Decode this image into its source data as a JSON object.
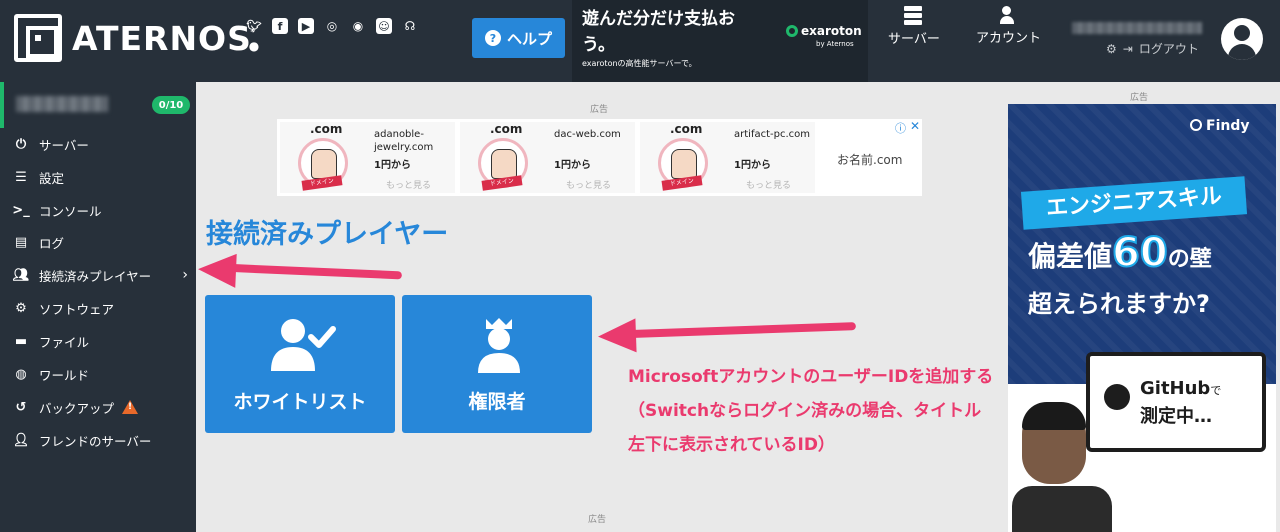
{
  "header": {
    "brand": "ATERNOS",
    "social_icons": [
      "twitter-icon",
      "facebook-icon",
      "youtube-icon",
      "instagram-icon",
      "reddit-icon",
      "discord-icon",
      "headset-icon",
      "github-icon"
    ],
    "help_label": "ヘルプ",
    "promo": {
      "title": "遊んだ分だけ支払おう。",
      "subtitle": "exarotonの高性能サーバーで。",
      "brand": "exaroton",
      "brand_by": "by Aternos"
    },
    "nav_server": "サーバー",
    "nav_account": "アカウント",
    "logout_label": "ログアウト"
  },
  "sidebar": {
    "player_count": "0/10",
    "items": [
      {
        "label": "サーバー",
        "icon": "power-icon"
      },
      {
        "label": "設定",
        "icon": "sliders-icon"
      },
      {
        "label": "コンソール",
        "icon": "terminal-icon"
      },
      {
        "label": "ログ",
        "icon": "file-icon"
      },
      {
        "label": "接続済みプレイヤー",
        "icon": "users-icon"
      },
      {
        "label": "ソフトウェア",
        "icon": "gears-icon"
      },
      {
        "label": "ファイル",
        "icon": "folder-icon"
      },
      {
        "label": "ワールド",
        "icon": "globe-icon"
      },
      {
        "label": "バックアップ",
        "icon": "history-icon"
      },
      {
        "label": "フレンドのサーバー",
        "icon": "user-lock-icon"
      }
    ]
  },
  "main": {
    "ad_label": "広告",
    "ad_cards": [
      {
        "dot": ".com",
        "domain": "adanoble-jewelry.com",
        "price": "1円から",
        "more": "もっと見る",
        "tag": "ドメイン"
      },
      {
        "dot": ".com",
        "domain": "dac-web.com",
        "price": "1円から",
        "more": "もっと見る",
        "tag": "ドメイン"
      },
      {
        "dot": ".com",
        "domain": "artifact-pc.com",
        "price": "1円から",
        "more": "もっと見る",
        "tag": "ドメイン"
      }
    ],
    "ad_brand": "お名前.com",
    "page_title": "接続済みプレイヤー",
    "tiles": [
      {
        "label": "ホワイトリスト",
        "icon": "user-check-icon"
      },
      {
        "label": "権限者",
        "icon": "user-crown-icon"
      }
    ],
    "annotation_lines": [
      "MicrosoftアカウントのユーザーIDを追加する",
      "（Switchならログイン済みの場合、タイトル",
      "左下に表示されているID）"
    ]
  },
  "side_ad": {
    "label": "広告",
    "brand": "Findy",
    "skill": "エンジニアスキル",
    "line1_a": "偏差値",
    "line1_num": "60",
    "line1_b": "の壁",
    "line2": "超えられますか?",
    "bubble_main": "GitHub",
    "bubble_de": "で",
    "bubble_sub": "測定中…"
  },
  "colors": {
    "header_bg": "#27303a",
    "accent_blue": "#2787d9",
    "accent_green": "#1fb86b",
    "annotation_pink": "#ea3a6e"
  }
}
